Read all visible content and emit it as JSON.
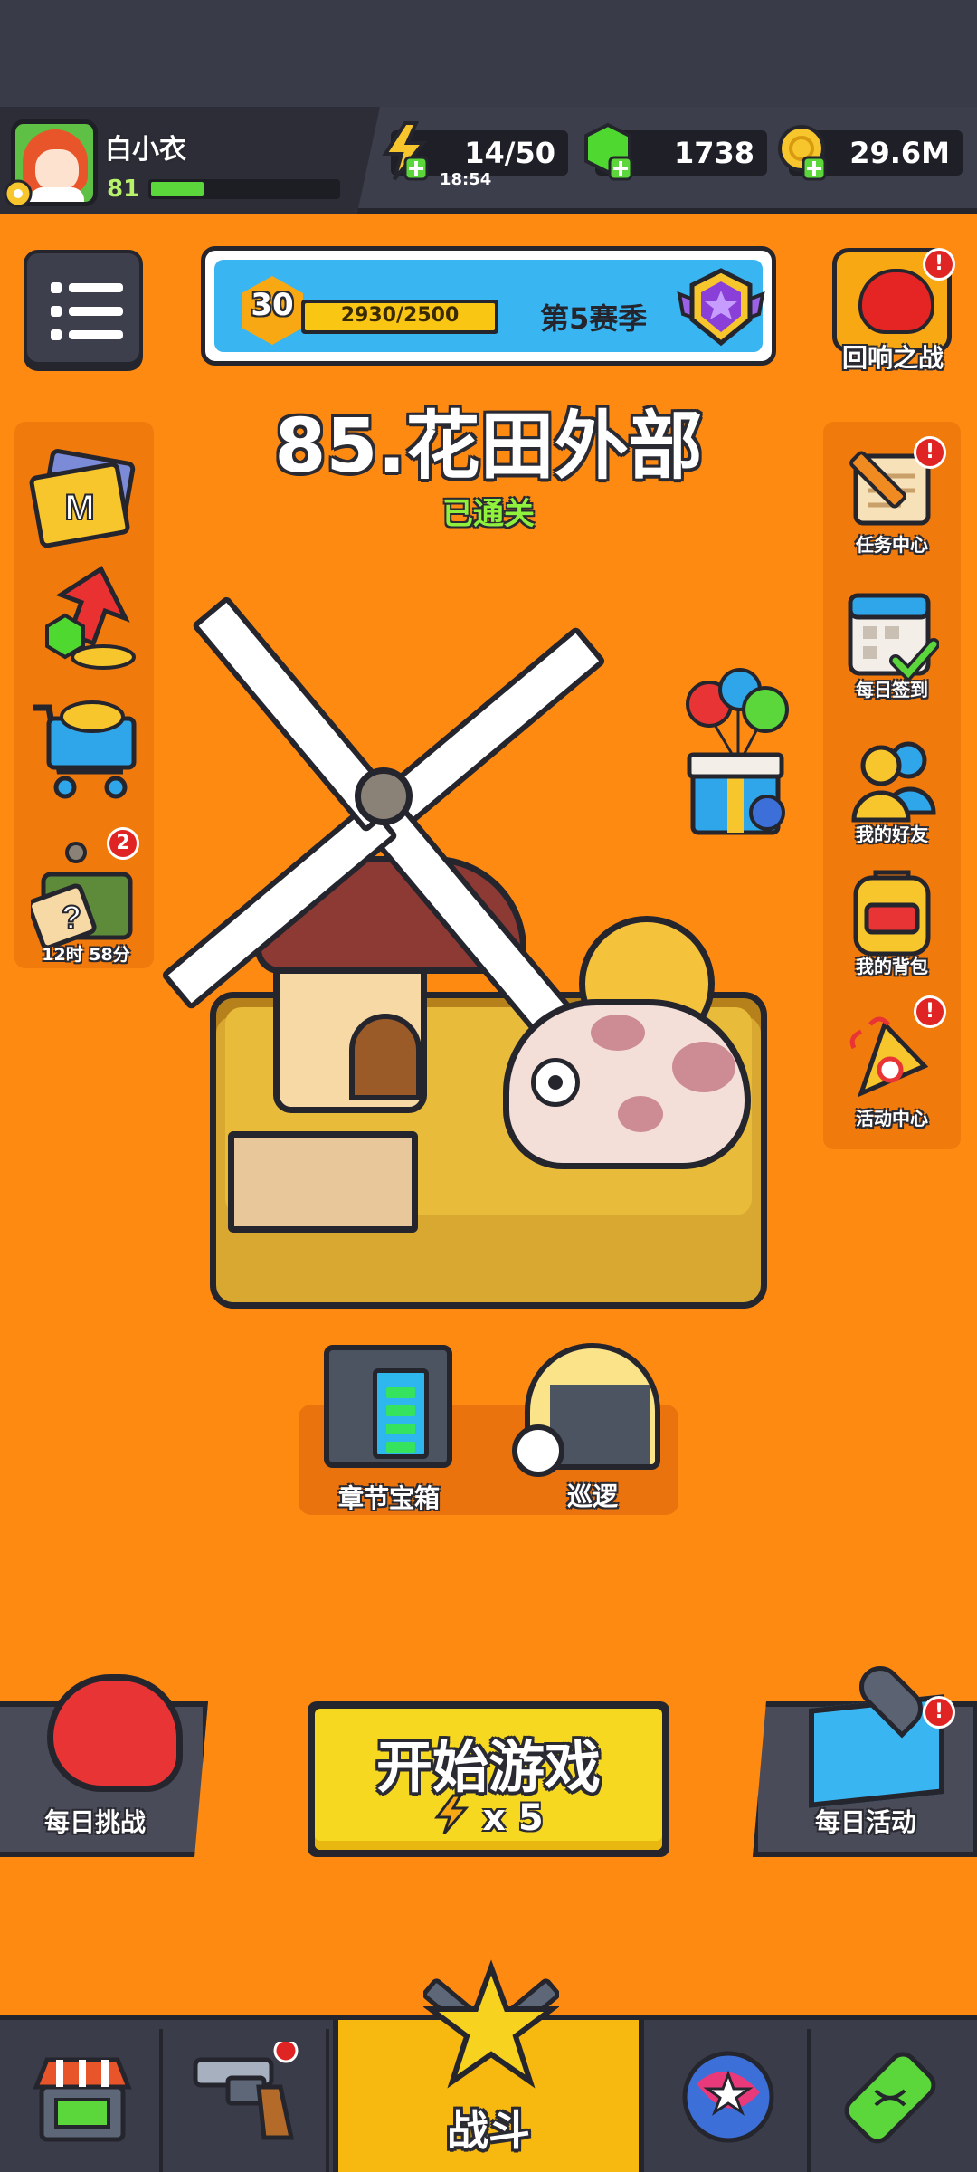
{
  "player": {
    "name": "白小衣",
    "level": "81",
    "xp_progress": 0.28
  },
  "resources": {
    "energy": "14/50",
    "energy_timer": "18:54",
    "gems": "1738",
    "coins": "29.6M"
  },
  "season": {
    "level": "30",
    "progress": "2930/2500",
    "progress_fraction": 1.0,
    "label": "第5赛季"
  },
  "echo_battle": {
    "label": "回响之战",
    "alert": "!"
  },
  "stage": {
    "title": "85.花田外部",
    "status": "已通关"
  },
  "left_menu": {
    "timer_chest_badge": "2",
    "timer_chest_time": "12时 58分"
  },
  "right_menu": {
    "items": [
      {
        "label": "任务中心",
        "alert": "!"
      },
      {
        "label": "每日签到"
      },
      {
        "label": "我的好友"
      },
      {
        "label": "我的背包"
      },
      {
        "label": "活动中心",
        "alert": "!"
      }
    ]
  },
  "middle": {
    "chapter_chest": "章节宝箱",
    "patrol": "巡逻"
  },
  "actions": {
    "daily_challenge": "每日挑战",
    "start_game": "开始游戏",
    "start_cost": "x 5",
    "daily_event": "每日活动",
    "daily_event_alert": "!"
  },
  "bottom_nav": {
    "battle": "战斗"
  },
  "colors": {
    "background": "#ff8a12",
    "dark": "#25252e",
    "panel": "#3d3e4b",
    "accent_yellow": "#f6d820",
    "cleared_green": "#8ff13b",
    "alert_red": "#e02424"
  }
}
